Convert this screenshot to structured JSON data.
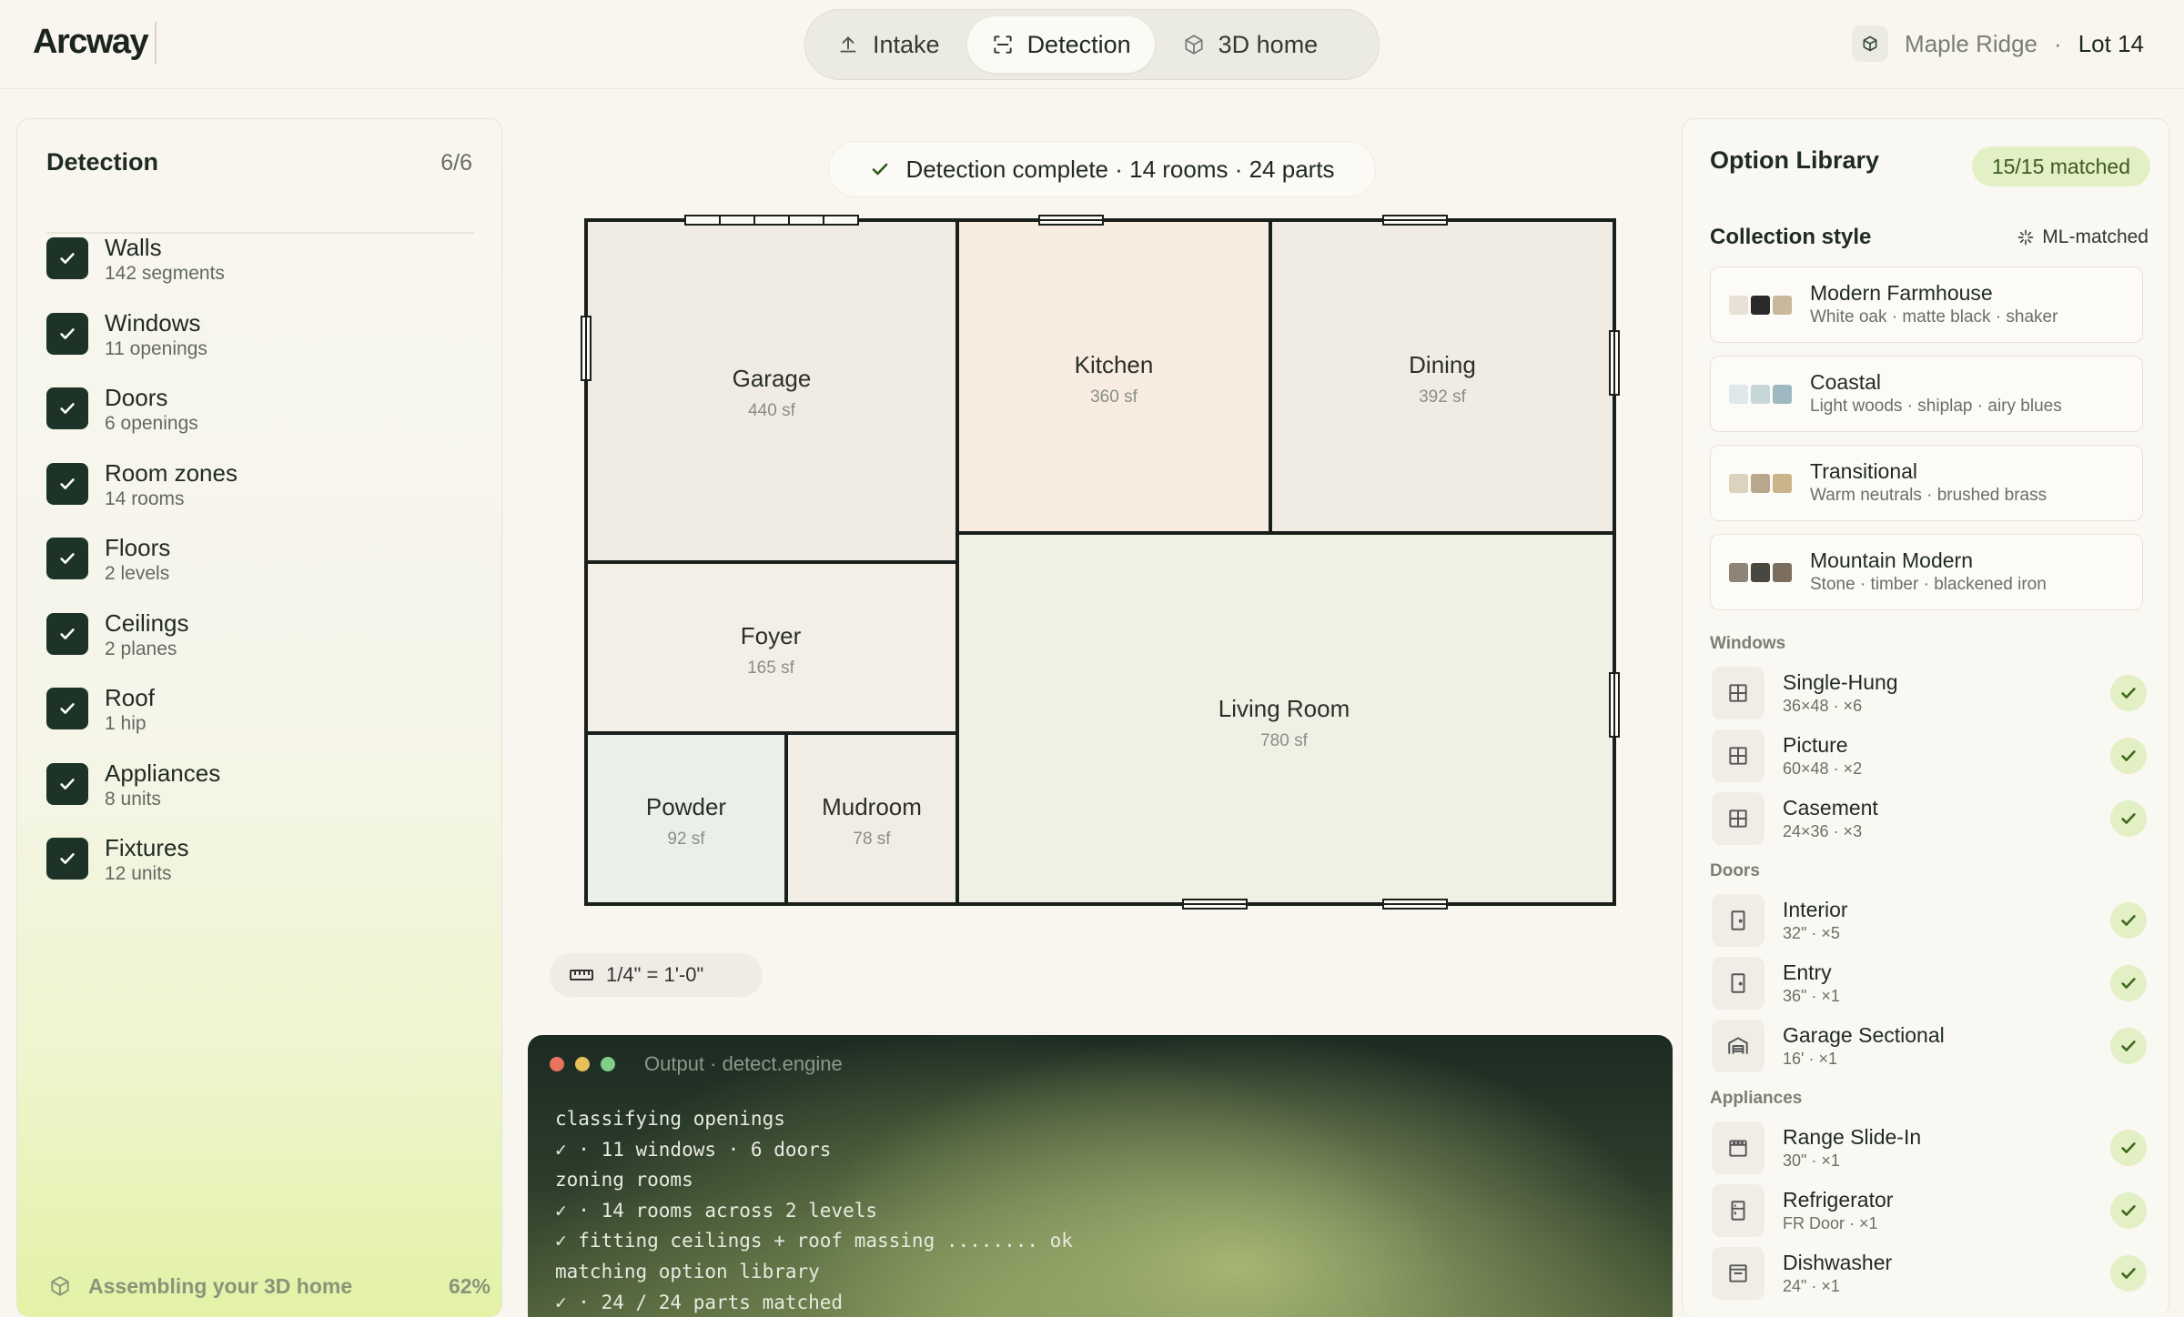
{
  "app": {
    "logo": "Arcway"
  },
  "tabs": [
    {
      "label": "Intake",
      "icon": "upload-icon"
    },
    {
      "label": "Detection",
      "icon": "scan-icon",
      "active": true
    },
    {
      "label": "3D home",
      "icon": "cube-icon"
    }
  ],
  "project": {
    "community": "Maple Ridge",
    "separator": "·",
    "lot": "Lot 14"
  },
  "detection_panel": {
    "title": "Detection",
    "count": "6/6",
    "items": [
      {
        "name": "Walls",
        "detail": "142 segments"
      },
      {
        "name": "Windows",
        "detail": "11 openings"
      },
      {
        "name": "Doors",
        "detail": "6 openings"
      },
      {
        "name": "Room zones",
        "detail": "14 rooms"
      },
      {
        "name": "Floors",
        "detail": "2 levels"
      },
      {
        "name": "Ceilings",
        "detail": "2 planes"
      },
      {
        "name": "Roof",
        "detail": "1 hip"
      },
      {
        "name": "Appliances",
        "detail": "8 units"
      },
      {
        "name": "Fixtures",
        "detail": "12 units"
      }
    ],
    "footer": {
      "label": "Assembling your 3D home",
      "progress_label": "62%",
      "progress": 0.62
    }
  },
  "status": {
    "text": "Detection complete · 14 rooms · 24 parts"
  },
  "floorplan": {
    "rooms": [
      {
        "name": "Garage",
        "area": "440 sf",
        "fill": "#f0ece4"
      },
      {
        "name": "Kitchen",
        "area": "360 sf",
        "fill": "#f8ebdf"
      },
      {
        "name": "Dining",
        "area": "392 sf",
        "fill": "#f0ece4"
      },
      {
        "name": "Foyer",
        "area": "165 sf",
        "fill": "#f3efe7"
      },
      {
        "name": "Living Room",
        "area": "780 sf",
        "fill": "#eef1e4"
      },
      {
        "name": "Powder",
        "area": "92 sf",
        "fill": "#e9f0ea"
      },
      {
        "name": "Mudroom",
        "area": "78 sf",
        "fill": "#f1ede5"
      }
    ]
  },
  "scale": {
    "label": "1/4\" = 1'-0\""
  },
  "terminal": {
    "title": "Output · detect.engine",
    "lines": [
      "classifying openings",
      "✓ · 11 windows · 6 doors",
      "zoning rooms",
      "✓ · 14 rooms across 2 levels",
      "✓ fitting ceilings + roof massing ........ ok",
      "matching option library",
      "✓ · 24 / 24 parts matched"
    ]
  },
  "library": {
    "title": "Option Library",
    "badge": "15/15 matched",
    "collection_label": "Collection style",
    "ml_label": "ML-matched",
    "styles": [
      {
        "name": "Modern Farmhouse",
        "desc": "White oak · matte black · shaker",
        "swatches": [
          "#e8e2d6",
          "#2a2a28",
          "#c9b89c"
        ]
      },
      {
        "name": "Coastal",
        "desc": "Light woods · shiplap · airy blues",
        "swatches": [
          "#dfe8ea",
          "#c7d6d8",
          "#9fb9c2"
        ]
      },
      {
        "name": "Transitional",
        "desc": "Warm neutrals · brushed brass",
        "swatches": [
          "#ddd2bd",
          "#b8a78c",
          "#cbb48a"
        ]
      },
      {
        "name": "Mountain Modern",
        "desc": "Stone · timber · blackened iron",
        "swatches": [
          "#8f8576",
          "#4a4640",
          "#7b6e5e"
        ]
      }
    ],
    "categories": {
      "windows": {
        "label": "Windows",
        "items": [
          {
            "name": "Single-Hung",
            "detail": "36×48 · ×6",
            "icon": "window-icon"
          },
          {
            "name": "Picture",
            "detail": "60×48 · ×2",
            "icon": "window-icon"
          },
          {
            "name": "Casement",
            "detail": "24×36 · ×3",
            "icon": "window-icon"
          }
        ]
      },
      "doors": {
        "label": "Doors",
        "items": [
          {
            "name": "Interior",
            "detail": "32\" · ×5",
            "icon": "door-icon"
          },
          {
            "name": "Entry",
            "detail": "36\" · ×1",
            "icon": "door-icon"
          },
          {
            "name": "Garage Sectional",
            "detail": "16' · ×1",
            "icon": "garage-door-icon"
          }
        ]
      },
      "appliances": {
        "label": "Appliances",
        "items": [
          {
            "name": "Range Slide-In",
            "detail": "30\" · ×1",
            "icon": "range-icon"
          },
          {
            "name": "Refrigerator",
            "detail": "FR Door · ×1",
            "icon": "refrigerator-icon"
          },
          {
            "name": "Dishwasher",
            "detail": "24\" · ×1",
            "icon": "dishwasher-icon"
          }
        ]
      }
    }
  }
}
